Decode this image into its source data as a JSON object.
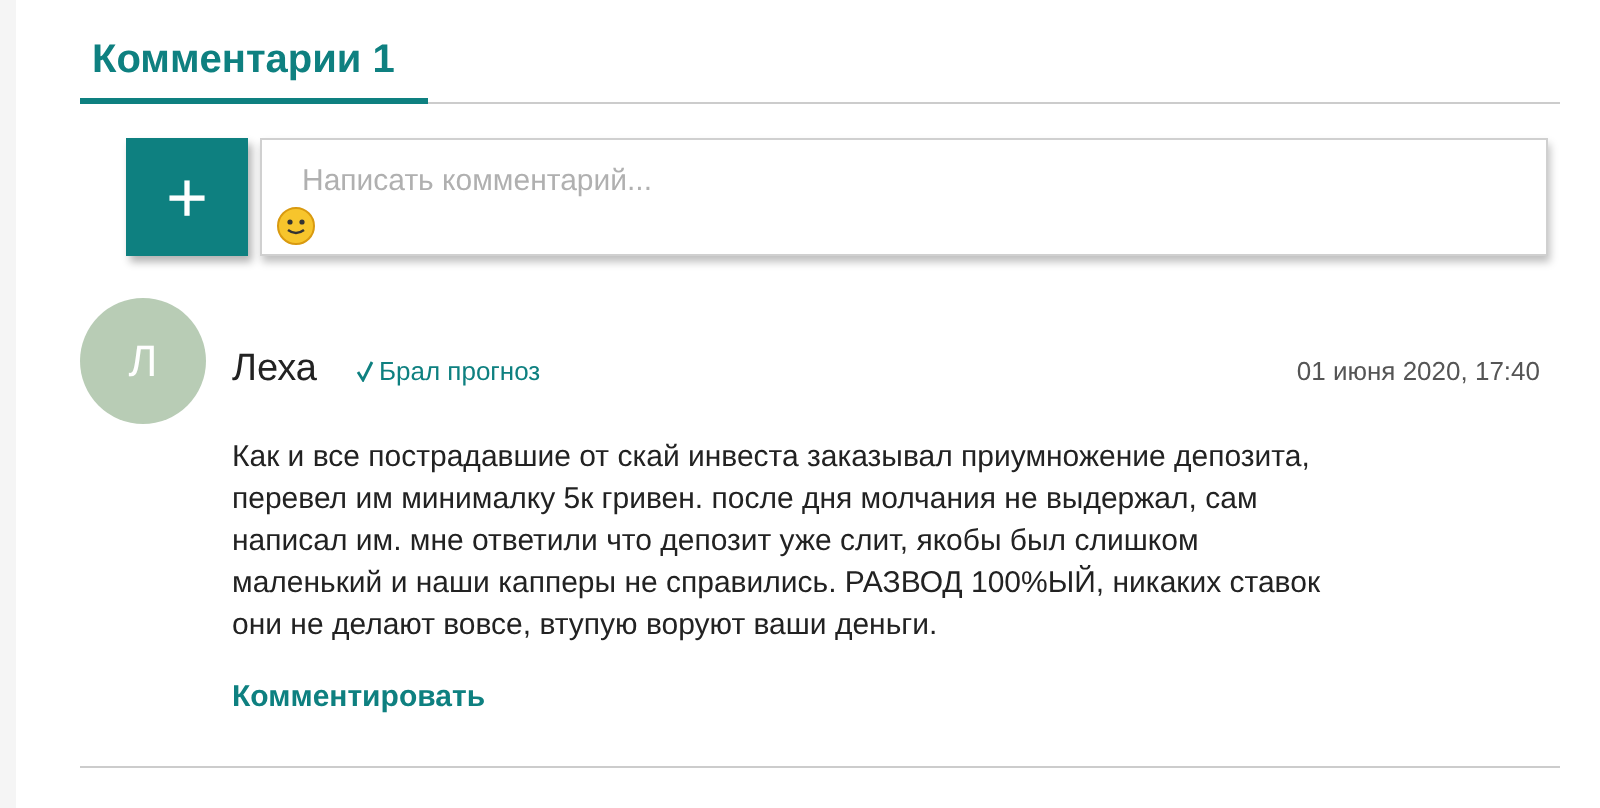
{
  "tabs": [
    {
      "label": "Комментарии 1",
      "selected": true
    }
  ],
  "composer": {
    "placeholder": "Написать комментарий...",
    "add_button": "+"
  },
  "comments": [
    {
      "avatar_letter": "Л",
      "author": "Леха",
      "badge": "Брал прогноз",
      "verified": true,
      "date": "01 июня 2020, 17:40",
      "text": "Как и все пострадавшие от скай инвеста заказывал приумножение депозита, перевел им минималку 5к гривен. после дня молчания не выдержал, сам написал им. мне ответили что депозит уже слит, якобы был слишком маленький и наши капперы не справились. РАЗВОД 100%ЫЙ, никаких ставок они не делают вовсе, втупую воруют ваши деньги.",
      "reply_link": "Комментировать"
    }
  ]
}
